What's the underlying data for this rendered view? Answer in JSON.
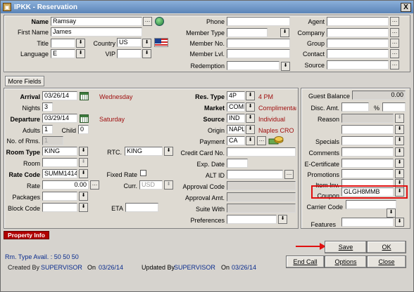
{
  "window": {
    "title": "IPKK - Reservation",
    "close": "X"
  },
  "profile": {
    "name_label": "Name",
    "name_value": "Ramsay",
    "first_label": "First Name",
    "first_value": "James",
    "title_label": "Title",
    "country_label": "Country",
    "country_value": "US",
    "language_label": "Language",
    "language_value": "E",
    "vip_label": "VIP",
    "phone_label": "Phone",
    "member_type_label": "Member Type",
    "member_no_label": "Member No.",
    "member_lvl_label": "Member Lvl.",
    "redemption_label": "Redemption",
    "agent_label": "Agent",
    "company_label": "Company",
    "group_label": "Group",
    "contact_label": "Contact",
    "source_label": "Source"
  },
  "more_fields": "More Fields",
  "stay": {
    "arrival_label": "Arrival",
    "arrival_value": "03/26/14",
    "arrival_day": "Wednesday",
    "nights_label": "Nights",
    "nights_value": "3",
    "departure_label": "Departure",
    "departure_value": "03/29/14",
    "departure_day": "Saturday",
    "adults_label": "Adults",
    "adults_value": "1",
    "child_label": "Child",
    "child_value": "0",
    "rooms_label": "No. of Rms.",
    "rooms_value": "1",
    "room_type_label": "Room Type",
    "room_type_value": "KING",
    "rtc_label": "RTC.",
    "rtc_value": "KING",
    "room_label": "Room",
    "rate_code_label": "Rate Code",
    "rate_code_value": "SUMM1414",
    "fixed_rate_label": "Fixed Rate",
    "rate_label": "Rate",
    "rate_value": "0.00",
    "curr_label": "Curr.",
    "curr_value": "USD",
    "packages_label": "Packages",
    "block_code_label": "Block Code",
    "eta_label": "ETA"
  },
  "res": {
    "res_type_label": "Res. Type",
    "res_type_value": "4P",
    "res_type_desc": "4 PM",
    "market_label": "Market",
    "market_value": "COMP",
    "market_desc": "Complimentar",
    "source_label": "Source",
    "source_value": "IND",
    "source_desc": "Individual",
    "origin_label": "Origin",
    "origin_value": "NAPL",
    "origin_desc": "Naples CRO",
    "payment_label": "Payment",
    "payment_value": "CA",
    "cc_label": "Credit Card No.",
    "exp_label": "Exp. Date",
    "alt_label": "ALT ID",
    "approval_code_label": "Approval Code",
    "approval_amt_label": "Approval Amt.",
    "suite_label": "Suite With",
    "preferences_label": "Preferences"
  },
  "right": {
    "balance_label": "Guest Balance",
    "balance_value": "0.00",
    "disc_label": "Disc. Amt.",
    "pct": "%",
    "reason_label": "Reason",
    "specials_label": "Specials",
    "comments_label": "Comments",
    "ecert_label": "E-Certificate",
    "promotions_label": "Promotions",
    "item_inv_label": "Item Inv.",
    "coupon_label": "Coupon",
    "coupon_value": "GLGH8MMB",
    "carrier_label": "Carrier Code",
    "features_label": "Features"
  },
  "footer": {
    "property_info": "Property Info",
    "rm_avail": "Rm. Type Avail. : 50 50 50",
    "created_by_label": "Created By",
    "created_by": "SUPERVISOR",
    "on1": "On",
    "created_on": "03/26/14",
    "updated_by_label": "Updated By",
    "updated_by": "SUPERVISOR",
    "on2": "On",
    "updated_on": "03/26/14"
  },
  "buttons": {
    "save": "Save",
    "ok": "OK",
    "end_call": "End Call",
    "options": "Options",
    "close": "Close"
  },
  "colors": {
    "highlight": "#e01010",
    "desc_text": "#a01010",
    "footer_text": "#0a2c8e"
  }
}
